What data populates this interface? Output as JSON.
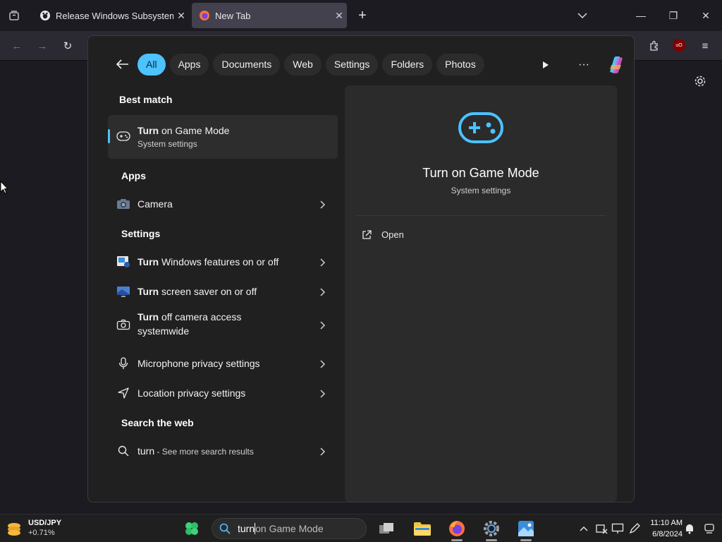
{
  "browser": {
    "tabs": [
      {
        "title": "Release Windows Subsystem For",
        "active": false,
        "favicon": "github-icon"
      },
      {
        "title": "New Tab",
        "active": true,
        "favicon": "firefox-icon"
      }
    ],
    "extension_badge": "uO"
  },
  "search_panel": {
    "filters": [
      "All",
      "Apps",
      "Documents",
      "Web",
      "Settings",
      "Folders",
      "Photos"
    ],
    "active_filter": "All",
    "best_match": {
      "heading": "Best match",
      "bold": "Turn",
      "rest": " on Game Mode",
      "sub": "System settings"
    },
    "apps": {
      "heading": "Apps",
      "items": [
        {
          "label": "Camera",
          "icon": "camera-app-icon"
        }
      ]
    },
    "settings": {
      "heading": "Settings",
      "items": [
        {
          "bold": "Turn",
          "rest": " Windows features on or off",
          "icon": "windows-features-icon"
        },
        {
          "bold": "Turn",
          "rest": " screen saver on or off",
          "icon": "screen-saver-icon"
        },
        {
          "bold": "Turn",
          "rest": " off camera access",
          "line2": "systemwide",
          "icon": "camera-icon"
        },
        {
          "bold": "",
          "rest": "Microphone privacy settings",
          "icon": "microphone-icon"
        },
        {
          "bold": "",
          "rest": "Location privacy settings",
          "icon": "location-icon"
        }
      ]
    },
    "web": {
      "heading": "Search the web",
      "query": "turn",
      "suffix": " - See more search results"
    },
    "preview": {
      "title": "Turn on Game Mode",
      "sub": "System settings",
      "action": "Open"
    }
  },
  "taskbar": {
    "widget_symbol": "USD/JPY",
    "widget_change": "+0.71%",
    "search_typed": "turn",
    "search_suggestion": " on Game Mode",
    "time": "11:10 AM",
    "date": "6/8/2024"
  },
  "colors": {
    "accent": "#4cc2ff",
    "panel": "#202020"
  }
}
